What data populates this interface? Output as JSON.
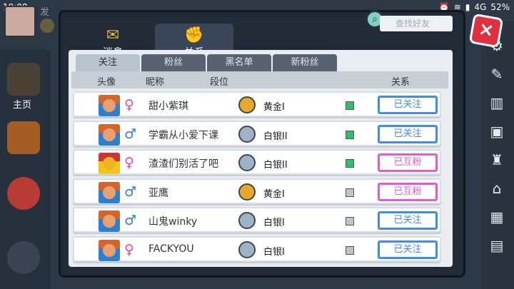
{
  "status_bar": {
    "time": "19:08",
    "signal": "4G",
    "battery": "52%"
  },
  "top_snippet": "发",
  "left_nav": {
    "home_label": "主页"
  },
  "top_tabs": [
    {
      "label": "消息",
      "icon": "envelope-icon",
      "active": false
    },
    {
      "label": "关系",
      "icon": "handshake-icon",
      "active": true
    }
  ],
  "search": {
    "placeholder": "查找好友"
  },
  "sub_tabs": [
    "关注",
    "粉丝",
    "黑名单",
    "新粉丝"
  ],
  "table_headers": {
    "avatar": "头像",
    "nickname": "昵称",
    "rank": "段位",
    "relation": "关系"
  },
  "rows": [
    {
      "gender": "female",
      "name": "甜小紫琪",
      "rank": "黄金I",
      "rank_tier": "gold",
      "online": true,
      "relation": "已关注",
      "relation_color": "#3f8de8"
    },
    {
      "gender": "male",
      "name": "学霸从小爱下课",
      "rank": "白银II",
      "rank_tier": "silver",
      "online": true,
      "relation": "已关注",
      "relation_color": "#3f8de8"
    },
    {
      "gender": "female",
      "name": "渣渣们别活了吧",
      "rank": "白银II",
      "rank_tier": "silver",
      "online": true,
      "relation": "已互粉",
      "relation_color": "#e25bd2"
    },
    {
      "gender": "male",
      "name": "亚鹰",
      "rank": "黄金I",
      "rank_tier": "gold",
      "online": false,
      "relation": "已互粉",
      "relation_color": "#e25bd2"
    },
    {
      "gender": "male",
      "name": "山鬼winky",
      "rank": "白银I",
      "rank_tier": "silver",
      "online": false,
      "relation": "已关注",
      "relation_color": "#3f8de8"
    },
    {
      "gender": "female",
      "name": "FACKYOU",
      "rank": "白银I",
      "rank_tier": "silver",
      "online": false,
      "relation": "已关注",
      "relation_color": "#3f8de8"
    }
  ]
}
